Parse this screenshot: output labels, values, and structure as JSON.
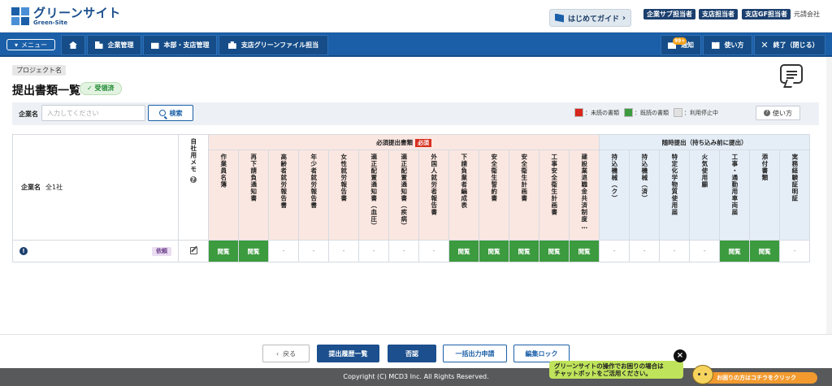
{
  "header": {
    "logo_main": "グリーンサイト",
    "logo_sub": "Green-Site",
    "guide_button": "はじめてガイド",
    "roles": [
      "企業サブ担当者",
      "支店担当者",
      "支店GF担当者"
    ],
    "user_name": "元請会社"
  },
  "nav": {
    "menu_label": "メニュー",
    "company_mgmt": "企業管理",
    "hq_branch_mgmt": "本部・支店管理",
    "branch_file": "支店グリーンファイル担当",
    "notices_badge": "99+",
    "notices": "通知",
    "usage": "使い方",
    "exit": "終了（閉じる）"
  },
  "page": {
    "project_name": "プロジェクト名",
    "title": "提出書類一覧",
    "status": "受領済"
  },
  "search": {
    "label": "企業名",
    "placeholder": "入力してください",
    "button": "検索"
  },
  "legend": {
    "unread": "：未読の書類",
    "read": "：既読の書類",
    "disabled": "：利用停止中",
    "usage_button": "使い方",
    "colors": {
      "unread": "#d7261b",
      "read": "#3c9a3f",
      "disabled": "#e1e1e1"
    }
  },
  "table": {
    "company_header": "企業名",
    "company_count": "全1社",
    "memo_header": "自社用メモ",
    "required_group": "必須提出書類",
    "required_tag": "必須",
    "optional_group": "随時提出（持ち込み前に提出）",
    "columns": [
      "作業員名簿",
      "再下請負通知書",
      "高齢者就労報告書",
      "年少者就労報告書",
      "女性就労報告書",
      "適正配置通知書（血圧）",
      "適正配置通知書（疾病）",
      "外国人就労者報告書",
      "下請負業者編成表",
      "安全衛生誓約書",
      "安全衛生計画書",
      "工事安全衛生計画書",
      "建設業退職金共済制度…",
      "持込機械（ク）",
      "持込機械（済）",
      "特定化学物質使用届",
      "火気使用願",
      "工事・通勤用車両届",
      "添付書類",
      "実務経験証明証"
    ],
    "row": {
      "info_icon": "!",
      "request_badge": "依頼",
      "cells": [
        "閲覧",
        "閲覧",
        "-",
        "-",
        "-",
        "-",
        "-",
        "-",
        "閲覧",
        "閲覧",
        "閲覧",
        "閲覧",
        "閲覧",
        "-",
        "-",
        "-",
        "-",
        "閲覧",
        "閲覧",
        "-"
      ]
    }
  },
  "footer": {
    "back": "戻る",
    "history": "提出履歴一覧",
    "reject": "否認",
    "bulk_output": "一括出力申請",
    "edit_lock": "編集ロック",
    "copyright": "Copyright (C) MCD3 Inc. All Rights Reserved.",
    "bot_message_line1": "グリーンサイトの操作でお困りの場合は",
    "bot_message_line2": "チャットボットをご活用ください。",
    "bot_close": "×",
    "bot_cta": "お困りの方はコチラをクリック"
  }
}
